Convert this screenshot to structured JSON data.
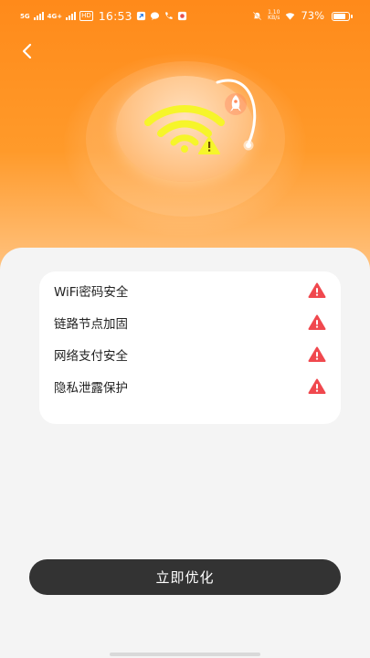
{
  "status_bar": {
    "network_1": "5G",
    "network_2": "4G+",
    "hd": "HD",
    "time": "16:53",
    "speed_value": "1.10",
    "speed_unit": "KB/s",
    "battery": "73%"
  },
  "header": {
    "back_icon": "chevron-left-icon"
  },
  "hero": {
    "icon": "wifi-warning-icon"
  },
  "checks": [
    {
      "label": "WiFi密码安全",
      "status_icon": "warning-icon"
    },
    {
      "label": "链路节点加固",
      "status_icon": "warning-icon"
    },
    {
      "label": "网络支付安全",
      "status_icon": "warning-icon"
    },
    {
      "label": "隐私泄露保护",
      "status_icon": "warning-icon"
    }
  ],
  "action": {
    "label": "立即优化"
  },
  "colors": {
    "accent": "#ff8a1a",
    "warning": "#f0484e",
    "wifi": "#f6f52a",
    "button": "#333333"
  }
}
